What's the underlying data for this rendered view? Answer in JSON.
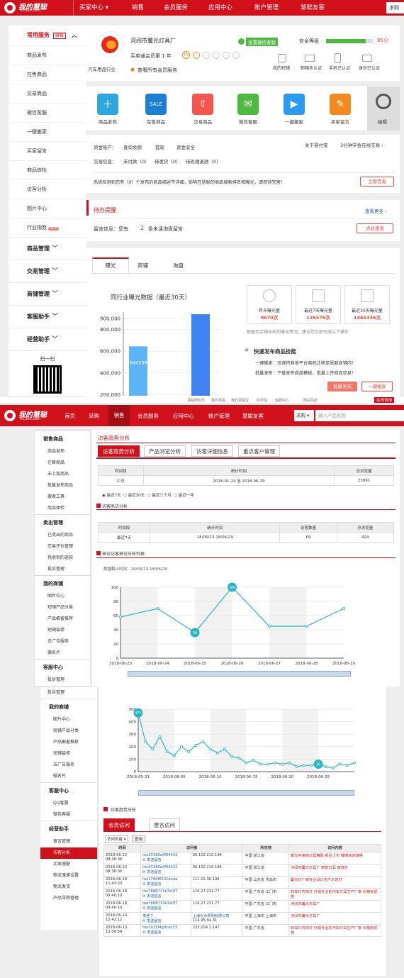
{
  "top": {
    "logo_cn": "我的慧聪",
    "logo_en": "HC360.com",
    "nav": [
      "买家中心 ▾",
      "销售",
      "会员服务",
      "应用中心",
      "账户管理",
      "慧聪友客"
    ],
    "search_stub": "求购"
  },
  "sidebar": {
    "header": "常用服务",
    "edit": "编辑",
    "items": [
      "商品发布",
      "在售商品",
      "交易商品",
      "微信客服",
      "一键搬家",
      "买家留言",
      "商品体检",
      "访客分析",
      "图片中心",
      "行业指数"
    ],
    "new_badge": "NEW",
    "groups": [
      "商品管理",
      "交易管理",
      "商铺管理",
      "客服助手",
      "经营助手"
    ],
    "qr_label": "扫一扫"
  },
  "profile": {
    "company": "河间市馨光灯具厂",
    "wechat_badge": "设置微信客服",
    "member": "买卖通会员第 1 年",
    "member_link": "查看所有会员服务",
    "industry": "汽车用品行业",
    "security_label": "安全等级",
    "security_score": "85分",
    "security_fill": 0.85,
    "icons": [
      "我的短铺",
      "邮箱未认证",
      "手机已认证",
      "身份已认证"
    ]
  },
  "quick": {
    "items": [
      "商品发布",
      "在售商品",
      "交易商品",
      "微信客服",
      "一键搬家",
      "买家留言"
    ],
    "edit": "编辑",
    "colors": [
      "#2ea7e0",
      "#1b7fd4",
      "#f5554a",
      "#4cba3f",
      "#2c9af0",
      "#f48a1d"
    ]
  },
  "account": {
    "row1": [
      "资金账户：",
      "查询余额",
      "提现",
      "资金安全"
    ],
    "link1": "关于慧付宝",
    "link2": "3分钟学会在线交易 ›",
    "row2": [
      "交易信息：",
      "未付款（0）",
      "待发货（0）",
      "待处理退款（0）"
    ],
    "notice": "系统检测到您有（0）个发布的商品描述不详细，影响在慧聪的商品搜索排名和曝光，请尽快完善！",
    "notice_btn": "立即完善"
  },
  "todo": {
    "title": "待办提醒",
    "more": "查看更多 ›",
    "prefix": "留言信息：您有",
    "count": "2",
    "suffix": "条未读询盘留言",
    "btn": "点此查看"
  },
  "exposure": {
    "tabs": [
      "曝光",
      "商铺",
      "询盘"
    ],
    "chart_title": "同行业曝光数据（最近30天）",
    "note": "根据您店铺当前的曝光情况，建议您立即完成以下操作",
    "tips_title": "快速发布商品技能",
    "tip1": "一键搬家：迅速将其他平台商机迁移至慧聪商铺内！",
    "tip2": "批量发布：下载发布商品模板，批量上传商品信息！",
    "btn1": "批量发布",
    "btn2": "一键搬家",
    "stats": [
      {
        "label": "昨天曝光量",
        "value": "8670次"
      },
      {
        "label": "最近7天曝光量",
        "value": "126576次"
      },
      {
        "label": "最近30天曝光量",
        "value": "1465336次"
      }
    ]
  },
  "chart_data": [
    {
      "type": "bar",
      "title": "同行业曝光数据（最近30天）",
      "yticks": [
        "900,000",
        "800,000",
        "600,000",
        "400,000",
        "200,000"
      ],
      "categories": [
        "",
        ""
      ],
      "values": [
        644558,
        940000
      ],
      "data_labels": [
        "644558",
        ""
      ],
      "colors": [
        "#5bb5f5",
        "#3e82f0"
      ],
      "ylim": [
        190000,
        960000
      ]
    },
    {
      "type": "line",
      "categories": [
        "2018-06-23",
        "2018-06-24",
        "2018-06-25",
        "2018-06-26",
        "2018-06-27",
        "2018-06-28",
        "2018-06-29"
      ],
      "values": [
        58,
        70,
        36,
        100,
        45,
        45,
        70
      ],
      "highlight_labels": [
        "",
        "",
        "36",
        "100",
        "",
        "",
        ""
      ],
      "yticks": [
        "100",
        "80",
        "60",
        "40",
        "20",
        "0"
      ],
      "ylim": [
        0,
        100
      ]
    },
    {
      "type": "line",
      "categories": [
        "2018-05-31",
        "2018-06-05",
        "2018-06-10",
        "2018-06-15",
        "2018-06-20",
        "2018-06-25"
      ],
      "values": [
        471,
        240,
        180,
        280,
        160,
        130,
        200,
        160,
        210,
        240,
        180,
        150,
        180,
        120,
        110,
        70,
        90,
        60,
        60,
        70,
        60,
        70,
        40,
        50,
        50,
        60,
        40,
        30,
        60,
        50,
        70
      ],
      "highlight_labels": [
        "471",
        "",
        "",
        "",
        "",
        "",
        "",
        "",
        "",
        "",
        "",
        "",
        "",
        "",
        "",
        "",
        "",
        "",
        "",
        "",
        "",
        "",
        "",
        "",
        "",
        "36",
        "",
        "",
        "",
        "",
        ""
      ],
      "yticks": [
        "500",
        "400",
        "300",
        "200",
        "100",
        "0"
      ],
      "ylim": [
        0,
        500
      ]
    }
  ],
  "top2": {
    "nav": [
      "首页",
      "采购",
      "销售",
      "会员服务",
      "应用中心",
      "账户管理",
      "慧聪友客"
    ],
    "search_sel": "求购",
    "search_placeholder": "输入产品名称",
    "strip": [
      "慧聪网首页",
      "我的慧聪",
      "我的慧聪宝",
      "商学院",
      "客服中心",
      "网站导航"
    ],
    "online": "在线咨询"
  },
  "sidebar2": {
    "g1": "销售商品",
    "g1_items": [
      "商品发布",
      "在售商品",
      "未上架商品",
      "批量发布商品",
      "搬家工具",
      "商品体检"
    ],
    "g2": "卖出管理",
    "g2_items": [
      "已卖出的商品",
      "交易评价管理",
      "我收到的退款",
      "投诉管理"
    ],
    "g3": "我的商铺",
    "g3_items": [
      "图片中心",
      "短铺产品分类",
      "产品橱窗推荐",
      "短铺装修",
      "去广告服务",
      "微名片"
    ],
    "g4": "客服中心",
    "g4_items": [
      "投诉管理"
    ],
    "g5": "我的商铺",
    "g5_items": [
      "图片中心",
      "短铺产品分类",
      "产品橱窗推荐",
      "短铺装修",
      "去广告服务",
      "微名片"
    ],
    "g6": "客服中心",
    "g6_items": [
      "QQ客服",
      "微信客服"
    ],
    "g7": "经营助手",
    "g7_items": [
      "留言管理",
      "访客分析",
      "买家速配",
      "物流速递设置",
      "物流发货",
      "产品导购管理"
    ]
  },
  "visitor": {
    "title": "访客趋势分析",
    "tabs": [
      "访客趋势分析",
      "产品浏览分析",
      "访客详细信息",
      "重点客户管理"
    ],
    "t1_headers": [
      "时间段",
      "统计时间",
      "总浏览量"
    ],
    "t1_row": [
      "汇总",
      "2018-01-24 至 2018-06-29",
      "23991"
    ],
    "radios": [
      "最近7天",
      "最近30天",
      "最近三个月",
      "最近一年"
    ],
    "sec1": "访客来访分析",
    "t2_headers": [
      "时间段",
      "统计时间",
      "访客数量",
      "总浏览量"
    ],
    "t2_row": [
      "最近7天",
      "18/06/23-18/06/29",
      "69",
      "424"
    ],
    "sec2": "来访访客来访分析列表",
    "cutoff": "数据截止时间：18/06/23-18/06/29",
    "sec3": "访客趋势分析",
    "tabs2": [
      "会员访问",
      "匿名访问"
    ],
    "filter": "访问内容 ▾",
    "filter_btn": "查询",
    "vt_headers": [
      "时间",
      "访问者",
      "",
      "所在地",
      "访问内容"
    ],
    "vt_rows": [
      [
        "2018-06-22 08:36:36",
        "mo33166a4f04432",
        "36.102.210.194",
        "中国 浙江省",
        "暖光中高档灯具精致 新品上市 慢慢欢的惊艳"
      ],
      [
        "2018-06-22 08:36:36",
        "mo33166a4f04432",
        "36.102.210.194",
        "中国 浙江省",
        "河间市馨光灯具厂 新款灯具 装饰灯"
      ],
      [
        "2018-06-18 11:43:20",
        "mo1789f6531eeda",
        "111.15.36.196",
        "中国 山东省 青岛市",
        "馨光灯厂家专业设计生产示范灯"
      ],
      [
        "2018-06-18 09:40:10",
        "mo7888713e7e0f7",
        "116.27.231.77",
        "中国 广东省 江门市",
        "转车灯内饰灯 外观专业的汽车灯具生产厂家 价格有优势"
      ],
      [
        "2018-06-18 09:40:10",
        "mo7888713e7e0f7",
        "116.27.231.77",
        "中国 广东省 江门市",
        "河间市馨光灯具厂"
      ],
      [
        "2018-06-14 12:42:12",
        "李佳丁",
        "114.95.94.31",
        "中国 上海市 上海市",
        "河间市馨光灯具厂"
      ],
      [
        "2018-06-13 12:00:54",
        "mo2025f4g91ec73",
        "223.104.1.147",
        "中国 广东省",
        "转车灯内饰灯 外观专业的汽车灯具生产厂家 价格有优势"
      ]
    ],
    "company_link": "上海光为照明有限公司",
    "send_msg": "发送留言"
  }
}
